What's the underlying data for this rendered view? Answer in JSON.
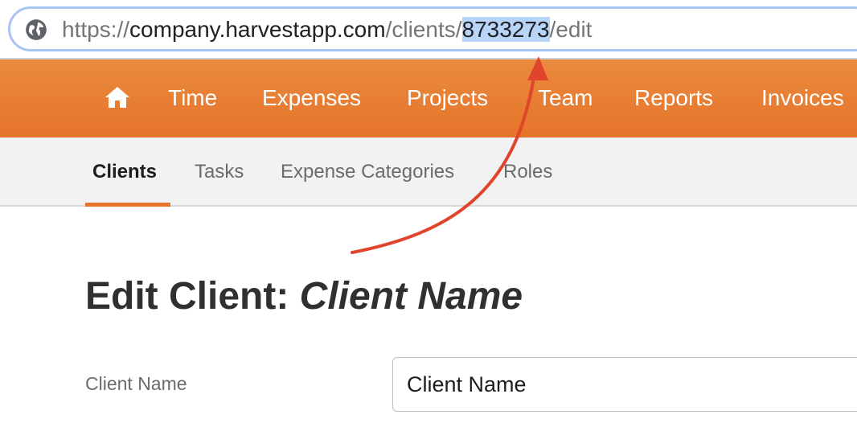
{
  "browser": {
    "url_prefix": "https://",
    "url_host": "company.harvestapp.com",
    "url_path_before": "/clients/",
    "url_selected_id": "8733273",
    "url_path_after": "/edit"
  },
  "main_nav": {
    "home_icon": "home-icon",
    "items": [
      "Time",
      "Expenses",
      "Projects",
      "Team",
      "Reports",
      "Invoices"
    ]
  },
  "sub_nav": {
    "items": [
      "Clients",
      "Tasks",
      "Expense Categories",
      "Roles"
    ],
    "active": "Clients"
  },
  "page": {
    "title_prefix": "Edit Client: ",
    "title_name": "Client Name"
  },
  "form": {
    "client_name_label": "Client Name",
    "client_name_value": "Client Name"
  },
  "colors": {
    "accent_orange": "#e5742a",
    "selection_blue": "#b8d4f7",
    "annotation_red": "#e0452b"
  }
}
